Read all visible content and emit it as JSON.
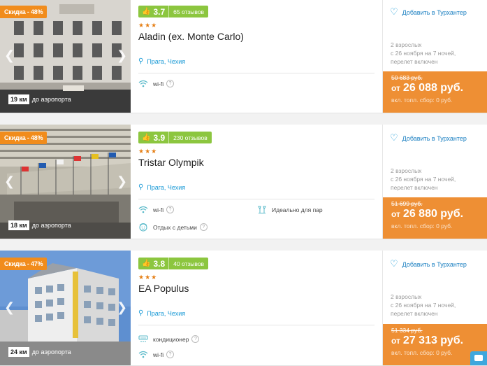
{
  "cards": [
    {
      "discount": "Скидка - 48%",
      "rating": "3.7",
      "reviews": "65 отзывов",
      "stars": "★★★",
      "name": "Aladin (ex. Monte Carlo)",
      "location": "Прага, Чехия",
      "distance_km": "19 км",
      "distance_label": "до аэропорта",
      "amenities": [
        {
          "icon": "wifi-icon",
          "label": "wi-fi"
        }
      ],
      "favorite": "Добавить в Турхантер",
      "details": [
        "2 взрослых",
        "с 26 ноября на 7 ночей,",
        "перелет включен"
      ],
      "old_price": "50 683 руб.",
      "price_from": "от",
      "price": "26 088 руб.",
      "fee": "вкл. топл. сбор: 0 руб."
    },
    {
      "discount": "Скидка - 48%",
      "rating": "3.9",
      "reviews": "230 отзывов",
      "stars": "★★★",
      "name": "Tristar Olympik",
      "location": "Прага, Чехия",
      "distance_km": "18 км",
      "distance_label": "до аэропорта",
      "amenities": [
        {
          "icon": "wifi-icon",
          "label": "wi-fi"
        },
        {
          "icon": "couple-icon",
          "label": "Идеально для пар"
        },
        {
          "icon": "kids-icon",
          "label": "Отдых с детьми"
        }
      ],
      "favorite": "Добавить в Турхантер",
      "details": [
        "2 взрослых",
        "с 26 ноября на 7 ночей,",
        "перелет включен"
      ],
      "old_price": "51 699 руб.",
      "price_from": "от",
      "price": "26 880 руб.",
      "fee": "вкл. топл. сбор: 0 руб."
    },
    {
      "discount": "Скидка - 47%",
      "rating": "3.8",
      "reviews": "40 отзывов",
      "stars": "★★★",
      "name": "EA Populus",
      "location": "Прага, Чехия",
      "distance_km": "24 км",
      "distance_label": "до аэропорта",
      "amenities": [
        {
          "icon": "air-conditioner-icon",
          "label": "кондиционер"
        },
        {
          "icon": "wifi-icon",
          "label": "wi-fi"
        }
      ],
      "favorite": "Добавить в Турхантер",
      "details": [
        "2 взрослых",
        "с 26 ноября на 7 ночей,",
        "перелет включен"
      ],
      "old_price": "51 334 руб.",
      "price_from": "от",
      "price": "27 313 руб.",
      "fee": "вкл. топл. сбор: 0 руб."
    }
  ],
  "colors": {
    "discount": "#f18c1c",
    "rating": "#8cc63f",
    "price_box": "#ee8f34",
    "link": "#1a9ad6"
  }
}
